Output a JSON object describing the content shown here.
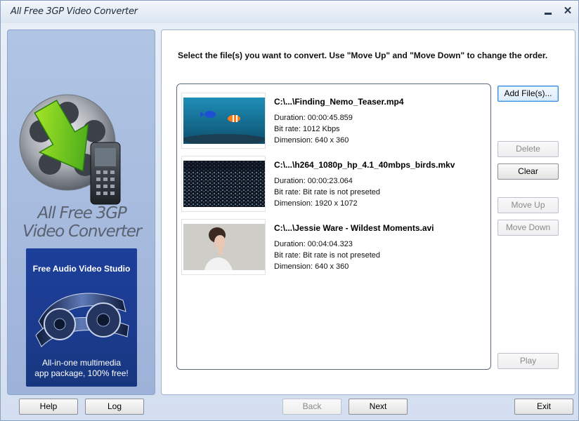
{
  "window": {
    "title": "All Free 3GP Video Converter"
  },
  "sidebar": {
    "logo_line1": "All Free 3GP",
    "logo_line2": "Video Converter",
    "promo": {
      "title": "Free Audio Video Studio",
      "desc_line1": "All-in-one multimedia",
      "desc_line2": "app package, 100% free!"
    }
  },
  "main": {
    "instruction": "Select the file(s) you want to convert. Use \"Move Up\" and \"Move Down\" to change the order.",
    "files": [
      {
        "name": "C:\\...\\Finding_Nemo_Teaser.mp4",
        "duration": "Duration: 00:00:45.859",
        "bitrate": "Bit rate: 1012 Kbps",
        "dimension": "Dimension: 640 x 360"
      },
      {
        "name": "C:\\...\\h264_1080p_hp_4.1_40mbps_birds.mkv",
        "duration": "Duration: 00:00:23.064",
        "bitrate": "Bit rate: Bit rate is not preseted",
        "dimension": "Dimension: 1920 x 1072"
      },
      {
        "name": "C:\\...\\Jessie Ware - Wildest Moments.avi",
        "duration": "Duration: 00:04:04.323",
        "bitrate": "Bit rate: Bit rate is not preseted",
        "dimension": "Dimension: 640 x 360"
      }
    ],
    "buttons": {
      "add_files": "Add File(s)...",
      "delete": "Delete",
      "clear": "Clear",
      "move_up": "Move Up",
      "move_down": "Move Down",
      "play": "Play"
    }
  },
  "footer": {
    "help": "Help",
    "log": "Log",
    "back": "Back",
    "next": "Next",
    "exit": "Exit"
  },
  "colors": {
    "accent": "#3a8ae0",
    "panel_bg": "#a9bde0",
    "promo_bg": "#1b3b8d"
  }
}
